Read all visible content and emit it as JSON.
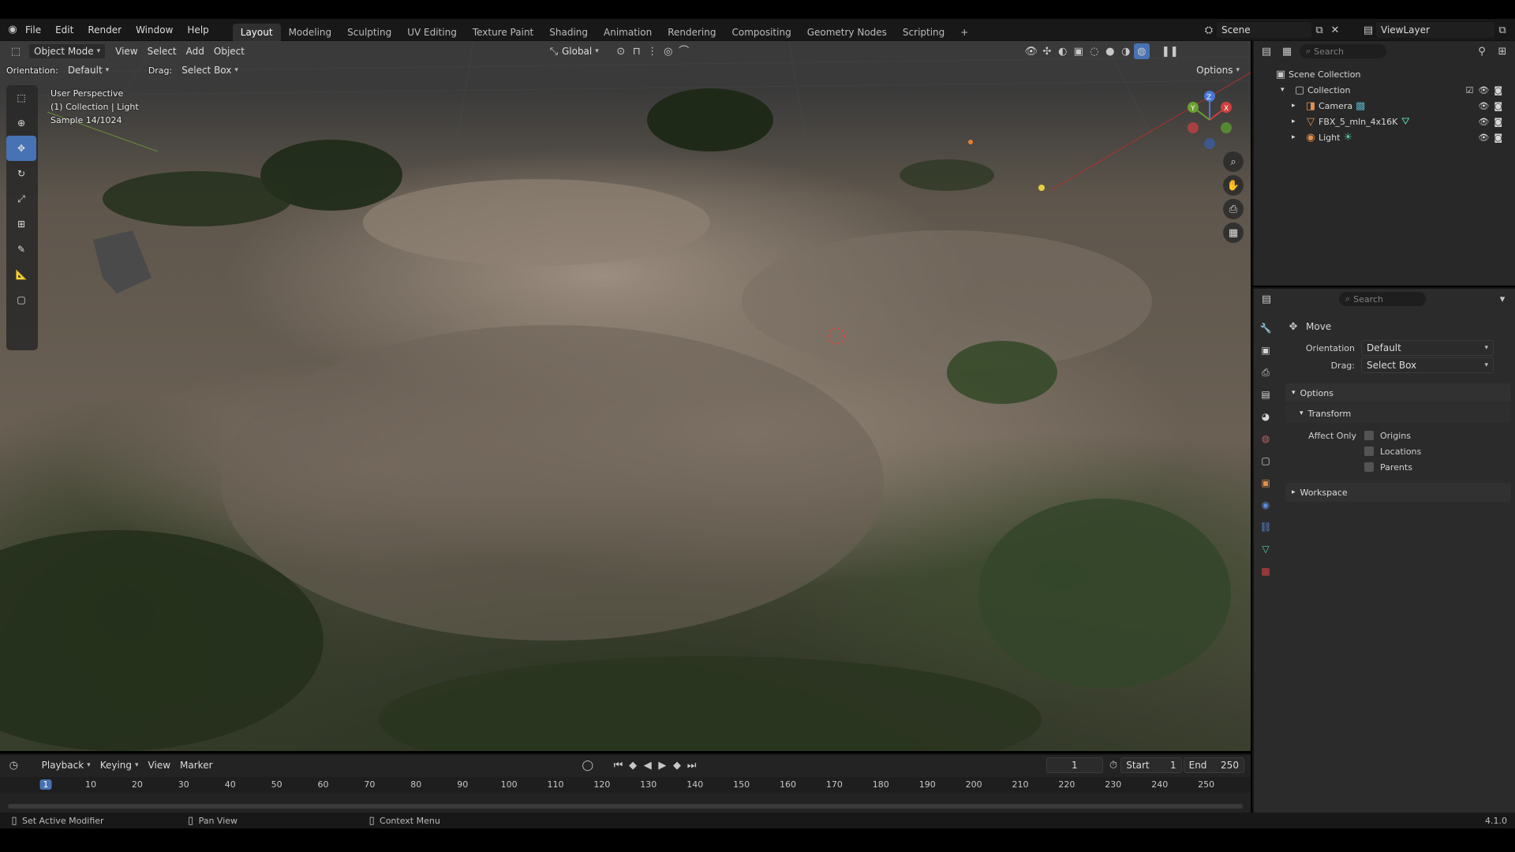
{
  "topbar": {
    "menus": [
      "File",
      "Edit",
      "Render",
      "Window",
      "Help"
    ],
    "workspaces": [
      "Layout",
      "Modeling",
      "Sculpting",
      "UV Editing",
      "Texture Paint",
      "Shading",
      "Animation",
      "Rendering",
      "Compositing",
      "Geometry Nodes",
      "Scripting"
    ],
    "active_workspace": "Layout",
    "add_tab": "+",
    "scene": "Scene",
    "view_layer": "ViewLayer"
  },
  "viewport_header": {
    "mode": "Object Mode",
    "menus": [
      "View",
      "Select",
      "Add",
      "Object"
    ],
    "transform": "Global",
    "orientation_label": "Orientation:",
    "orientation_value": "Default",
    "drag_label": "Drag:",
    "drag_value": "Select Box",
    "options": "Options"
  },
  "viewport_overlay": {
    "line1": "User Perspective",
    "line2": "(1) Collection | Light",
    "line3": "Sample 14/1024"
  },
  "gizmo": {
    "x": "X",
    "y": "Y",
    "z": "Z"
  },
  "outliner": {
    "search_placeholder": "Search",
    "scene_collection": "Scene Collection",
    "collection": "Collection",
    "items": [
      {
        "name": "Camera",
        "icon": "camera-icon"
      },
      {
        "name": "FBX_5_mln_4x16K",
        "icon": "mesh-icon"
      },
      {
        "name": "Light",
        "icon": "light-icon"
      }
    ]
  },
  "properties": {
    "search_placeholder": "Search",
    "tool_title": "Move",
    "orientation_label": "Orientation",
    "orientation_value": "Default",
    "drag_label": "Drag:",
    "drag_value": "Select Box",
    "options_section": "Options",
    "transform_section": "Transform",
    "affect_only": "Affect Only",
    "checkbox_origins": "Origins",
    "checkbox_locations": "Locations",
    "checkbox_parents": "Parents",
    "workspace_section": "Workspace"
  },
  "timeline": {
    "menus": [
      "Playback",
      "Keying",
      "View",
      "Marker"
    ],
    "current_frame": "1",
    "start_label": "Start",
    "start_value": "1",
    "end_label": "End",
    "end_value": "250",
    "ruler": [
      "1",
      "10",
      "20",
      "30",
      "40",
      "50",
      "60",
      "70",
      "80",
      "90",
      "100",
      "110",
      "120",
      "130",
      "140",
      "150",
      "160",
      "170",
      "180",
      "190",
      "200",
      "210",
      "220",
      "230",
      "240",
      "250"
    ]
  },
  "statusbar": {
    "hint1": "Set Active Modifier",
    "hint2": "Pan View",
    "hint3": "Context Menu",
    "version": "4.1.0"
  },
  "colors": {
    "accent": "#4772b3",
    "header": "#181818",
    "panel": "#282828"
  }
}
